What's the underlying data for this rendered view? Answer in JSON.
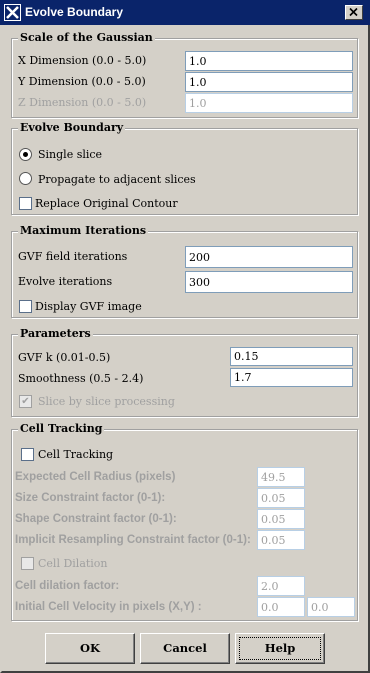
{
  "window": {
    "title": "Evolve Boundary",
    "icons": {
      "app": "app-x-icon",
      "close": "close-icon"
    }
  },
  "gaussian": {
    "legend": "Scale of the Gaussian",
    "x_label": "X Dimension (0.0 - 5.0)",
    "x_value": "1.0",
    "y_label": "Y Dimension (0.0 - 5.0)",
    "y_value": "1.0",
    "z_label": "Z Dimension (0.0 - 5.0)",
    "z_value": "1.0"
  },
  "evolve": {
    "legend": "Evolve Boundary",
    "single_slice": "Single slice",
    "propagate": "Propagate to adjacent slices",
    "replace": "Replace Original Contour"
  },
  "iterations": {
    "legend": "Maximum Iterations",
    "gvf_label": "GVF field iterations",
    "gvf_value": "200",
    "evolve_label": "Evolve iterations",
    "evolve_value": "300",
    "display_gvf": "Display GVF image"
  },
  "parameters": {
    "legend": "Parameters",
    "k_label": "GVF k (0.01-0.5)",
    "k_value": "0.15",
    "smooth_label": "Smoothness (0.5 - 2.4)",
    "smooth_value": "1.7",
    "slice_by_slice": "Slice by slice processing"
  },
  "tracking": {
    "legend": "Cell Tracking",
    "cell_tracking": "Cell Tracking",
    "radius_label": "Expected Cell Radius (pixels)",
    "radius_value": "49.5",
    "size_label": "Size Constraint factor (0-1):",
    "size_value": "0.05",
    "shape_label": "Shape Constraint factor (0-1):",
    "shape_value": "0.05",
    "implicit_label": "Implicit Resampling Constraint factor (0-1):",
    "implicit_value": "0.05",
    "dilation": "Cell Dilation",
    "dilation_label": "Cell dilation factor:",
    "dilation_value": "2.0",
    "velocity_label": "Initial Cell Velocity in pixels (X,Y) :",
    "velocity_x": "0.0",
    "velocity_y": "0.0"
  },
  "buttons": {
    "ok": "OK",
    "cancel": "Cancel",
    "help": "Help"
  }
}
